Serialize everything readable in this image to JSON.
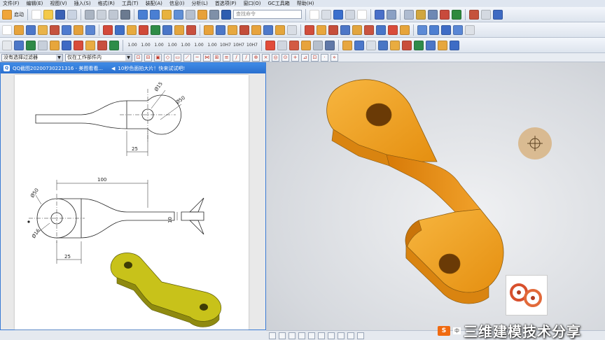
{
  "menu": [
    "文件(F)",
    "编辑(E)",
    "视图(V)",
    "插入(S)",
    "格式(R)",
    "工具(T)",
    "装配(A)",
    "信息(I)",
    "分析(L)",
    "首选项(P)",
    "窗口(O)",
    "GC工具箱",
    "帮助(H)"
  ],
  "toolbar": {
    "start_label": "启动",
    "search_placeholder": "查找命令",
    "tolerance_buttons": [
      "1.00",
      "1.00",
      "1.00",
      "1.00",
      "1.00",
      "1.00",
      "1.00",
      "10H7",
      "10H7",
      "10H7"
    ]
  },
  "filterbar": {
    "selection_filter": "没有选择过滤器",
    "scope": "仅在工作部件内"
  },
  "qq_window": {
    "title": "QQ截图20200730221316 - 美图看看...",
    "tip": "10秒色面拍大片！快来试试吧!"
  },
  "drawing": {
    "dims": [
      "Ø15",
      "Ø50",
      "25",
      "100",
      "Ø50",
      "Ø16",
      "25",
      "10"
    ]
  },
  "brand": {
    "logo": "S",
    "small_text": "中",
    "text": "三维建模技术分享"
  },
  "colors": {
    "part_orange": "#f2a31b",
    "part_yellow": "#c8c21a",
    "title_blue": "#2a6fcf"
  }
}
